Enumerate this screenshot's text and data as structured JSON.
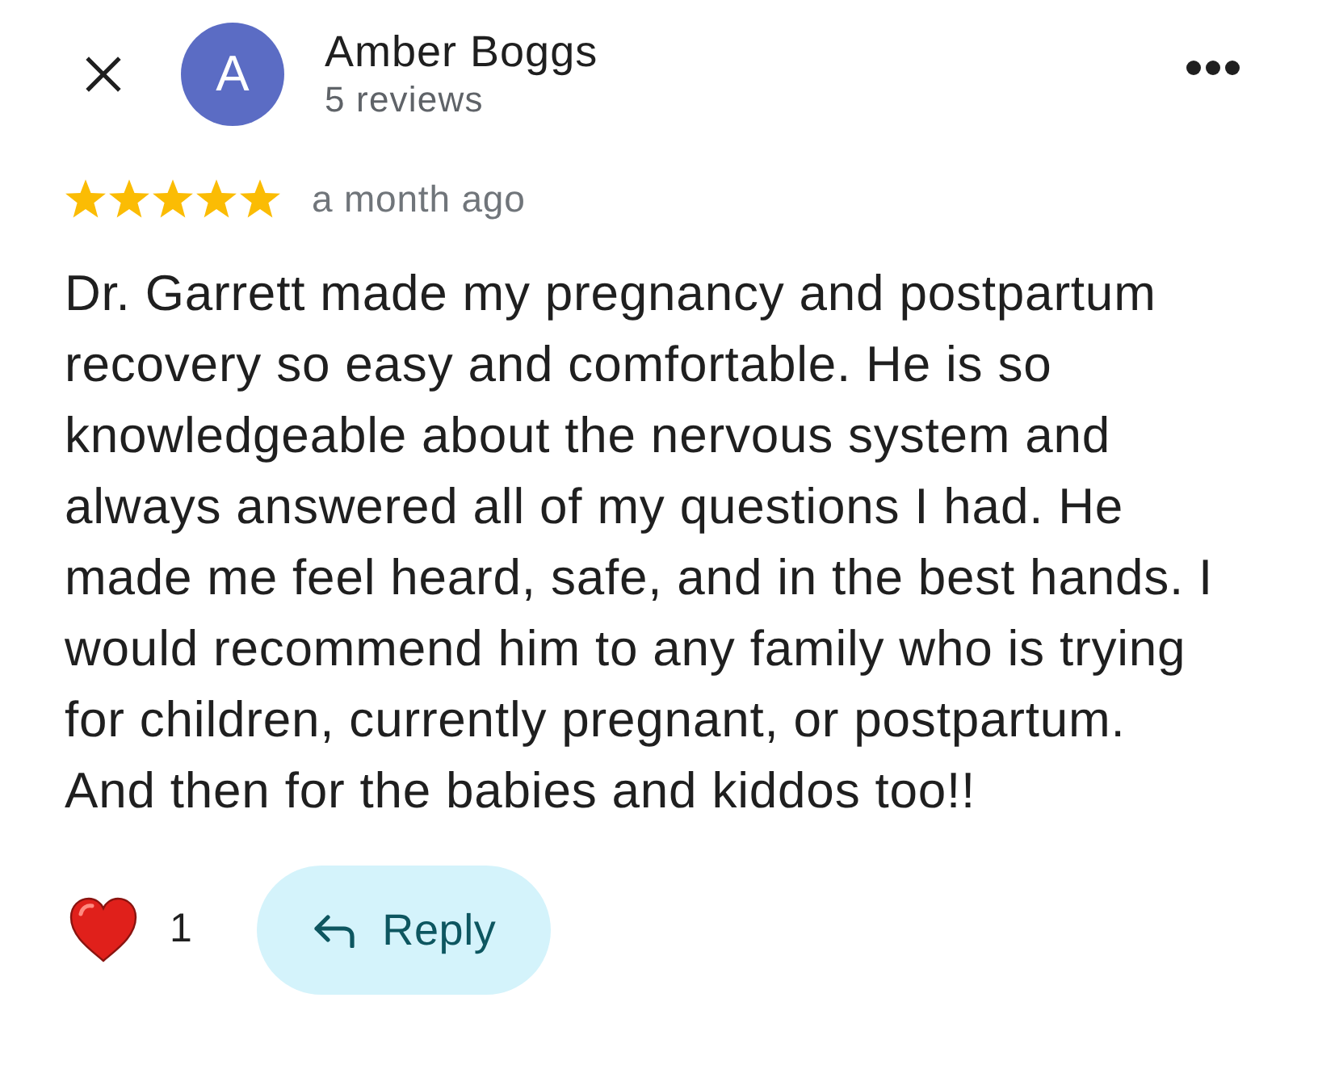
{
  "reviewer": {
    "avatar_letter": "A",
    "name": "Amber Boggs",
    "reviews": "5 reviews"
  },
  "review": {
    "stars": 5,
    "time": "a month ago",
    "text": "Dr. Garrett made my pregnancy and postpartum recovery so easy and comfortable. He is so knowledgeable about the nervous system and always answered all of my questions I had. He made me feel heard, safe, and in the best hands. I would recommend him to any family who is trying for children, currently pregnant, or postpartum. And then for the babies and kiddos too!!"
  },
  "reactions": {
    "count": "1"
  },
  "reply_button": {
    "label": "Reply"
  }
}
